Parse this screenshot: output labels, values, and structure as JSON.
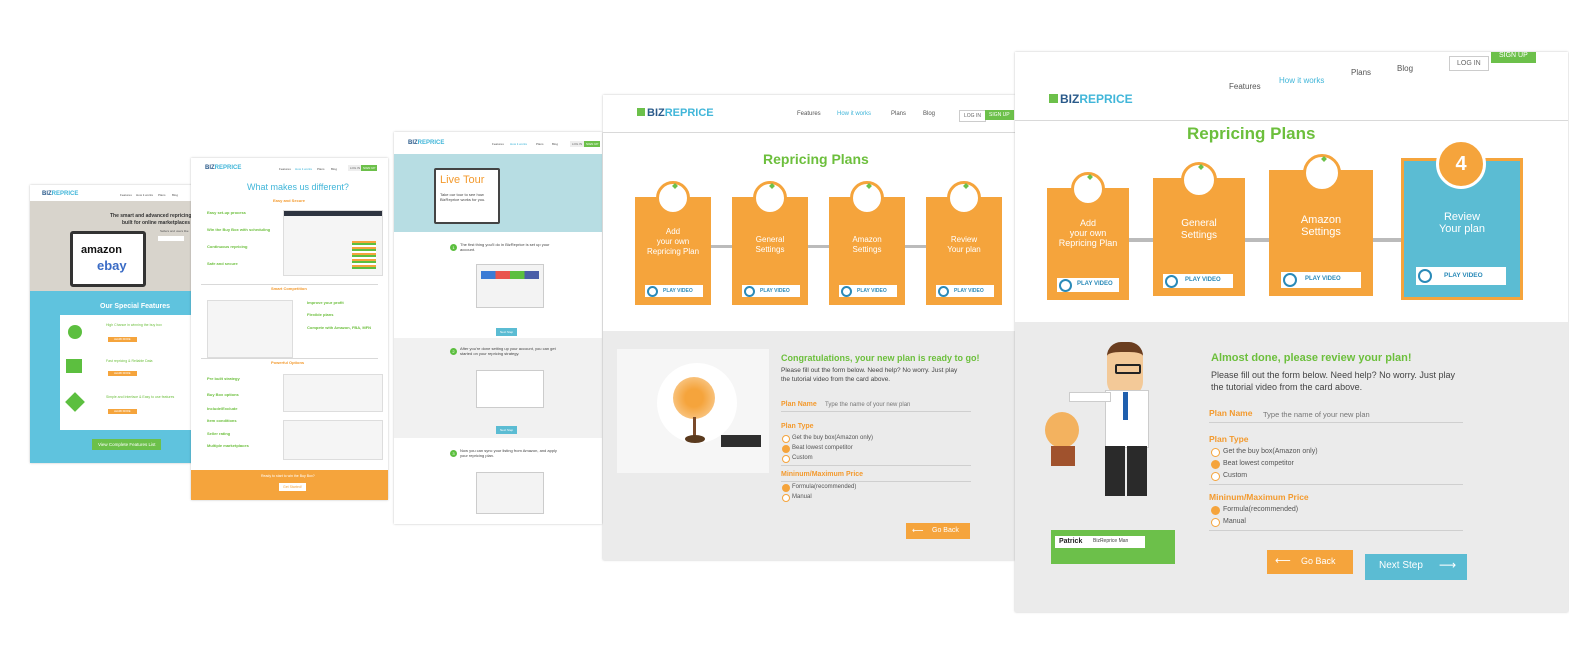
{
  "brand": {
    "prefix": "BIZ",
    "suffix": "REPRICE"
  },
  "nav": {
    "features": "Features",
    "how": "How it works",
    "plans": "Plans",
    "blog": "Blog",
    "login": "LOG IN",
    "signup": "SIGN UP"
  },
  "card1": {
    "hero_title": "The smart and advanced repricing",
    "hero_sub": "built for online marketplaces",
    "hero_line": "Sellers and users like",
    "logo_amazon": "amazon",
    "logo_ebay": "ebay",
    "features_title": "Our Special Features",
    "feature1": "High Chance in winning the buy box",
    "feature2": "Fast repricing & Reliable Data",
    "feature3": "Simple and Interface & Easy to use features",
    "learn_more": "LEARN MORE",
    "view_all": "View Complete Features List"
  },
  "card2": {
    "title": "What makes us different?",
    "sec1": "Easy and Secure",
    "items1": [
      "Easy set-up process",
      "Win the Buy Box with scheduling",
      "Continuous repricing",
      "Safe and secure"
    ],
    "sec2": "Smart Competition",
    "items2": [
      "Improve your profit",
      "Flexible plans",
      "Compete with Amazon, FBA, MFN"
    ],
    "sec3": "Powerful Options",
    "items3": [
      "Pre built strategy",
      "Buy Box options",
      "Include/Exclude",
      "Item conditions",
      "Seller rating",
      "Multiple marketplaces"
    ],
    "cta_text": "Ready to start to win the Buy Box?",
    "cta_button": "Get Started!"
  },
  "card3": {
    "hero_title": "Live Tour",
    "hero_text": "Take our tour to see how BizReprice works for you.",
    "step1_num": "1",
    "step1": "The first thing you'll do in BizReprice is set up your account.",
    "step2_num": "2",
    "step2": "After you're done setting up your account, you can get started on your repricing strategy.",
    "step3_num": "3",
    "step3": "Now you can sync your listing from Amazon, and apply your repricing plan.",
    "next_step": "Next Step"
  },
  "card4": {
    "title": "Repricing Plans",
    "steps": [
      {
        "label1": "Add",
        "label2": "your own",
        "label3": "Repricing Plan"
      },
      {
        "label1": "General",
        "label2": "Settings",
        "label3": ""
      },
      {
        "label1": "Amazon",
        "label2": "Settings",
        "label3": ""
      },
      {
        "label1": "Review",
        "label2": "Your plan",
        "label3": ""
      }
    ],
    "play_video": "PLAY VIDEO",
    "congrats": "Congratulations, your new plan is ready to go!",
    "help1": "Please fill out the form below. Need help? No worry. Just play",
    "help2": "the tutorial video from the card above.",
    "plan_name": "Plan Name",
    "plan_placeholder": "Type the name of your new plan",
    "plan_type": "Plan Type",
    "type_options": [
      "Get the buy box(Amazon only)",
      "Beat lowest competitor",
      "Custom"
    ],
    "minmax": "Mininum/Maximum Price",
    "price_options": [
      "Formula(recommended)",
      "Manual"
    ],
    "go_back": "Go Back"
  },
  "card5": {
    "title": "Repricing Plans",
    "steps": [
      {
        "label1": "Add",
        "label2": "your own",
        "label3": "Repricing Plan"
      },
      {
        "label1": "General",
        "label2": "Settings",
        "label3": ""
      },
      {
        "label1": "Amazon",
        "label2": "Settings",
        "label3": ""
      },
      {
        "label1": "Review",
        "label2": "Your plan",
        "label3": ""
      }
    ],
    "step4_num": "4",
    "play_video": "PLAY VIDEO",
    "almost": "Almost done, please review your plan!",
    "help1": "Please fill out the form below. Need help? No worry. Just play",
    "help2": "the tutorial video from the card above.",
    "plan_name": "Plan Name",
    "plan_placeholder": "Type the name of your new plan",
    "plan_type": "Plan Type",
    "type_options": [
      "Get the buy box(Amazon only)",
      "Beat lowest competitor",
      "Custom"
    ],
    "minmax": "Mininum/Maximum Price",
    "price_options": [
      "Formula(recommended)",
      "Manual"
    ],
    "name_tag": "Patrick",
    "name_role": "BizReprice Man",
    "go_back": "Go Back",
    "next_step": "Next Step"
  }
}
